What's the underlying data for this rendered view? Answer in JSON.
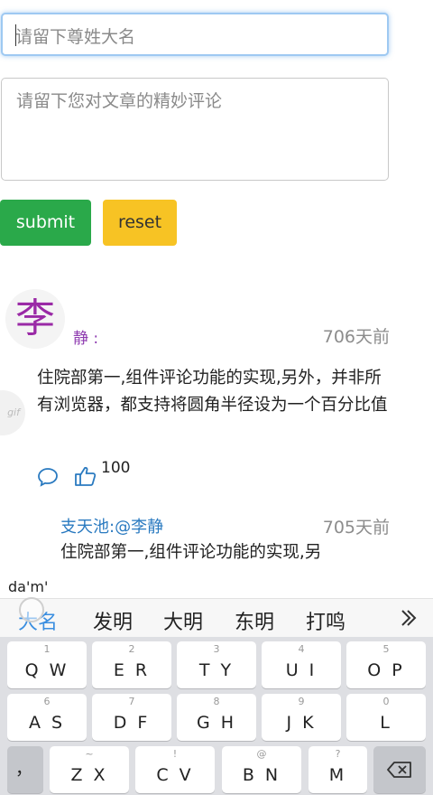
{
  "form": {
    "name_placeholder": "请留下尊姓大名",
    "comment_placeholder": "请留下您对文章的精妙评论",
    "submit_label": "submit",
    "reset_label": "reset"
  },
  "comment": {
    "avatar_text": "李",
    "author": "静 :",
    "time": "706天前",
    "badge": "gif",
    "text": "住院部第一,组件评论功能的实现,另外，并非所有浏览器，都支持将圆角半径设为一个百分比值",
    "likes": "100"
  },
  "reply": {
    "author": "支天池:@李静",
    "time": "705天前",
    "text": "住院部第一,组件评论功能的实现,另"
  },
  "ime": {
    "composition": "da'm'",
    "candidates": [
      "大名",
      "发明",
      "大明",
      "东明",
      "打鸣"
    ]
  },
  "keyboard": {
    "row1": [
      {
        "num": "1",
        "label": "Q W"
      },
      {
        "num": "2",
        "label": "E R"
      },
      {
        "num": "3",
        "label": "T Y"
      },
      {
        "num": "4",
        "label": "U I"
      },
      {
        "num": "5",
        "label": "O P"
      }
    ],
    "row2": [
      {
        "num": "6",
        "label": "A S"
      },
      {
        "num": "7",
        "label": "D F"
      },
      {
        "num": "8",
        "label": "G H"
      },
      {
        "num": "9",
        "label": "J K"
      },
      {
        "num": "0",
        "label": "L"
      }
    ],
    "row3": [
      {
        "num": "",
        "label": "，"
      },
      {
        "num": "~",
        "label": "Z X"
      },
      {
        "num": "!",
        "label": "C V"
      },
      {
        "num": "@",
        "label": "B N"
      },
      {
        "num": "?",
        "label": "M"
      }
    ]
  },
  "colors": {
    "submit": "#2aa94a",
    "reset": "#f7c324",
    "author": "#8e3bb0",
    "reply_author": "#2a7ac0",
    "candidate_active": "#3a8ee0"
  }
}
